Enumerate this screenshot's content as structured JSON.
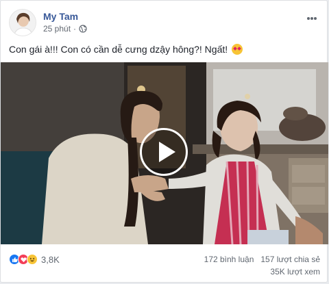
{
  "post": {
    "author": "My Tam",
    "time": "25 phút",
    "privacy_icon": "globe-icon",
    "message": "Con gái à!!! Con có cần dễ cưng dzậy hông?! Ngất!",
    "message_emoji": "heart-eyes-emoji",
    "options_icon": "more-dots-icon"
  },
  "video": {
    "play_icon": "play-icon"
  },
  "footer": {
    "reaction_icons": [
      "like-icon",
      "love-icon",
      "haha-icon"
    ],
    "reaction_count": "3,8K",
    "comments": "172 bình luận",
    "shares": "157 lượt chia sẻ",
    "views": "35K lượt xem"
  },
  "colors": {
    "author_link": "#385898",
    "like": "#1877f2",
    "love": "#f33e58",
    "haha": "#f7c436"
  }
}
